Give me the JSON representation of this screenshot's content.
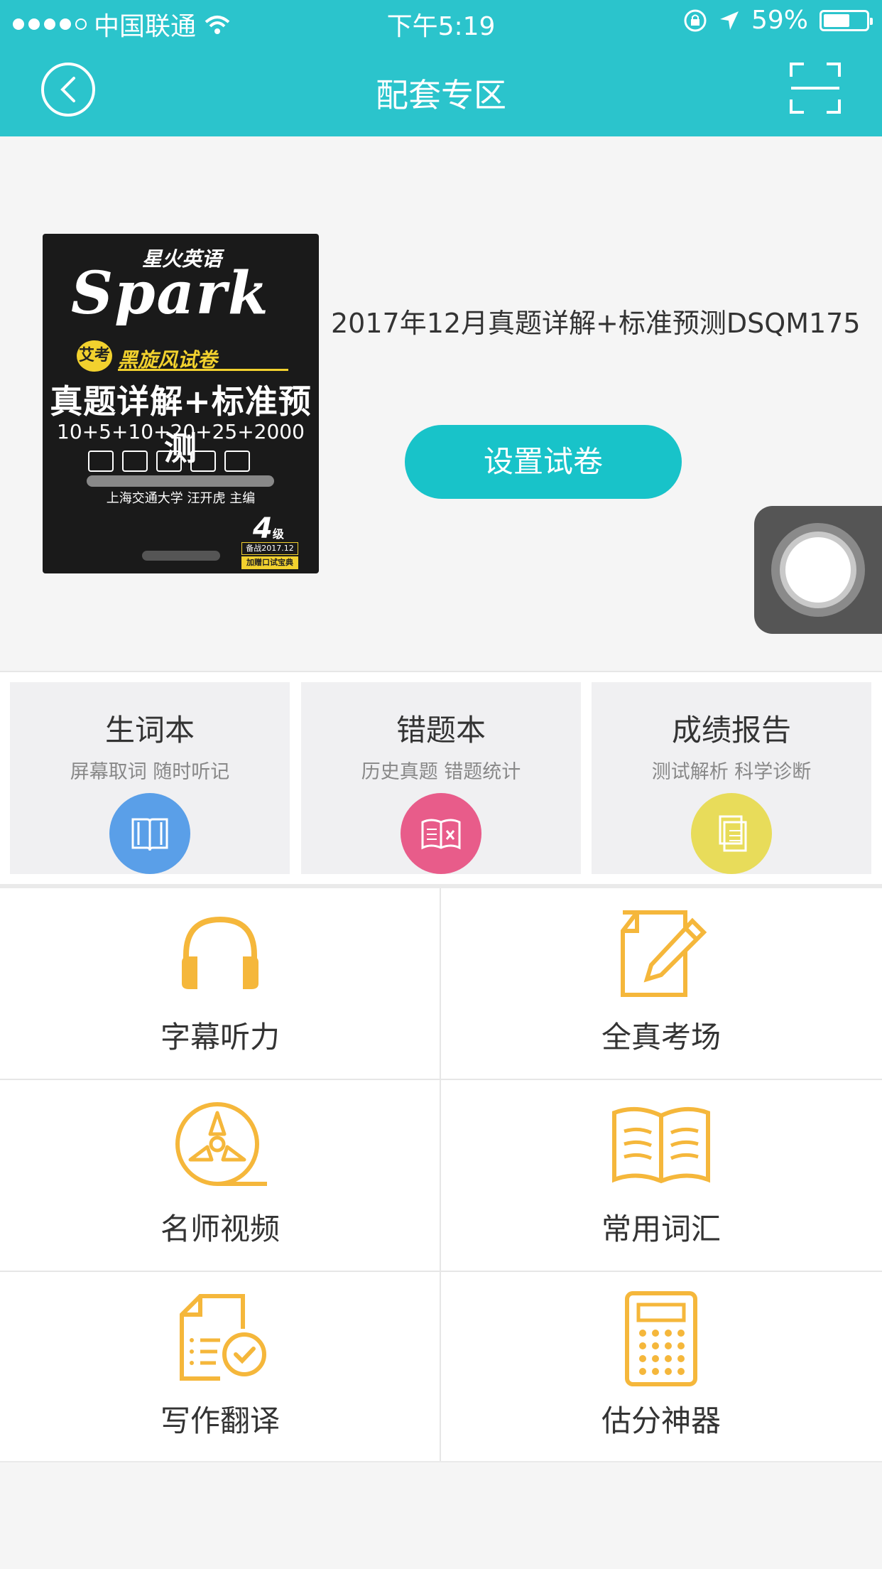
{
  "status_bar": {
    "carrier": "中国联通",
    "time": "下午5:19",
    "battery": "59%"
  },
  "nav": {
    "title": "配套专区"
  },
  "book": {
    "title": "2017年12月真题详解+标准预测DSQM175",
    "cover": {
      "brand_cn": "星火英语",
      "brand": "Spark",
      "series": "艾考",
      "series_name": "黑旋风试卷",
      "headline": "真题详解+标准预测",
      "numbers": "10+5+10+20+25+2000",
      "author": "上海交通大学  汪开虎  主编",
      "level": "4",
      "level_unit": "级",
      "tag1": "备战2017.12",
      "tag2": "加赠口试宝典"
    },
    "setup_button": "设置试卷"
  },
  "cards": [
    {
      "title": "生词本",
      "subtitle": "屏幕取词 随时听记",
      "icon": "book-icon",
      "color": "#5a9fe8"
    },
    {
      "title": "错题本",
      "subtitle": "历史真题 错题统计",
      "icon": "wrong-book-icon",
      "color": "#e85c8a"
    },
    {
      "title": "成绩报告",
      "subtitle": "测试解析 科学诊断",
      "icon": "report-icon",
      "color": "#e8dc5a"
    }
  ],
  "features": [
    {
      "label": "字幕听力",
      "icon": "headphones-icon"
    },
    {
      "label": "全真考场",
      "icon": "paper-pencil-icon"
    },
    {
      "label": "名师视频",
      "icon": "film-reel-icon"
    },
    {
      "label": "常用词汇",
      "icon": "open-book-icon"
    },
    {
      "label": "写作翻译",
      "icon": "document-check-icon"
    },
    {
      "label": "估分神器",
      "icon": "calculator-icon"
    }
  ],
  "colors": {
    "accent": "#2bc4cc",
    "button": "#18c3c9",
    "icon": "#f5b73b"
  }
}
